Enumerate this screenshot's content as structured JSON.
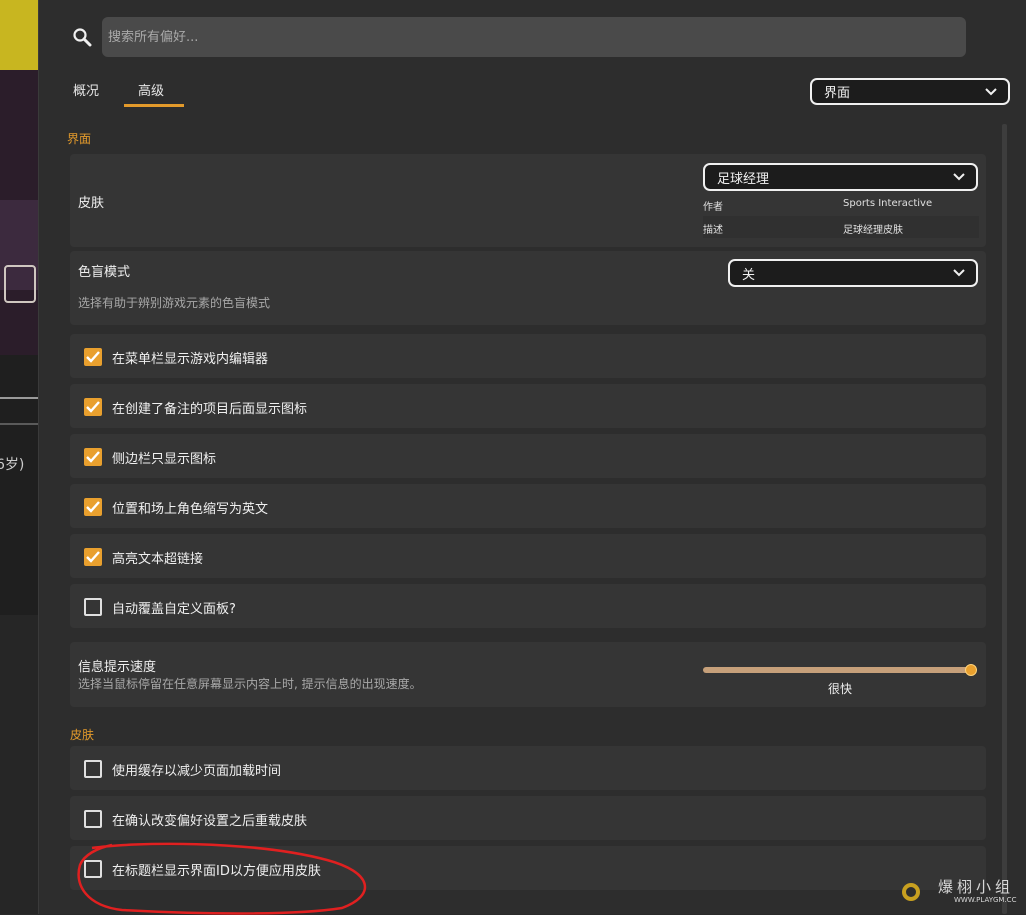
{
  "background": {
    "partial_text": "6岁)"
  },
  "search": {
    "placeholder": "搜索所有偏好..."
  },
  "tabs": [
    {
      "label": "概况"
    },
    {
      "label": "高级"
    }
  ],
  "category_dropdown": {
    "value": "界面"
  },
  "sections": {
    "interface_title": "界面",
    "skin_title": "皮肤"
  },
  "skin_setting": {
    "label": "皮肤",
    "dropdown_value": "足球经理",
    "author_label": "作者",
    "author_value": "Sports Interactive",
    "desc_label": "描述",
    "desc_value": "足球经理皮肤"
  },
  "colorblind": {
    "label": "色盲模式",
    "description": "选择有助于辨别游戏元素的色盲模式",
    "dropdown_value": "关"
  },
  "interface_checks": [
    {
      "label": "在菜单栏显示游戏内编辑器",
      "checked": true
    },
    {
      "label": "在创建了备注的项目后面显示图标",
      "checked": true
    },
    {
      "label": "侧边栏只显示图标",
      "checked": true
    },
    {
      "label": "位置和场上角色缩写为英文",
      "checked": true
    },
    {
      "label": "高亮文本超链接",
      "checked": true
    },
    {
      "label": "自动覆盖自定义面板?",
      "checked": false
    }
  ],
  "tooltip_speed": {
    "label": "信息提示速度",
    "description": "选择当鼠标停留在任意屏幕显示内容上时, 提示信息的出现速度。",
    "value_label": "很快",
    "value_fraction": 1.0
  },
  "skin_checks": [
    {
      "label": "使用缓存以减少页面加载时间",
      "checked": false
    },
    {
      "label": "在确认改变偏好设置之后重载皮肤",
      "checked": false
    },
    {
      "label": "在标题栏显示界面ID以方便应用皮肤",
      "checked": false
    }
  ],
  "colors": {
    "accent": "#e39a2b",
    "panel_bg": "#2d2d2d",
    "card_bg": "#353535",
    "annotation": "#e02020"
  },
  "watermark": {
    "text": "爆栩小组",
    "url": "WWW.PLAYGM.CC"
  }
}
